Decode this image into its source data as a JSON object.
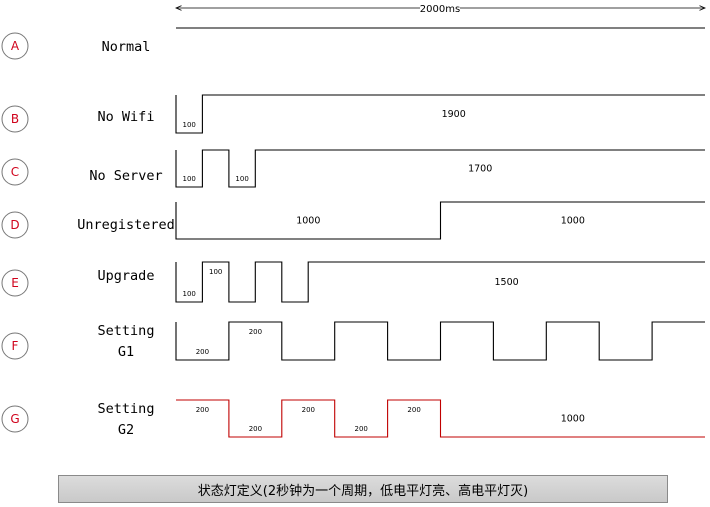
{
  "period": "2000ms",
  "colors": {
    "normal_wave": "#000000",
    "highlight_wave": "#c00000",
    "badge": "#d0021b",
    "highlight_text": "#3355dd"
  },
  "rows": [
    {
      "letter": "A",
      "label": [
        "Normal"
      ],
      "highlight": false,
      "segments": [
        {
          "level": "high",
          "ms": 2000,
          "label": ""
        }
      ]
    },
    {
      "letter": "B",
      "label": [
        "No Wifi"
      ],
      "highlight": false,
      "segments": [
        {
          "level": "low",
          "ms": 100,
          "label": "100"
        },
        {
          "level": "high",
          "ms": 1900,
          "label": "1900"
        }
      ]
    },
    {
      "letter": "C",
      "label": [
        "No Server"
      ],
      "highlight": false,
      "segments": [
        {
          "level": "low",
          "ms": 100,
          "label": "100"
        },
        {
          "level": "high",
          "ms": 100,
          "label": ""
        },
        {
          "level": "low",
          "ms": 100,
          "label": "100"
        },
        {
          "level": "high",
          "ms": 1700,
          "label": "1700"
        }
      ]
    },
    {
      "letter": "D",
      "label": [
        "Unregistered"
      ],
      "highlight": false,
      "segments": [
        {
          "level": "low",
          "ms": 1000,
          "label": "1000"
        },
        {
          "level": "high",
          "ms": 1000,
          "label": "1000"
        }
      ]
    },
    {
      "letter": "E",
      "label": [
        "Upgrade"
      ],
      "highlight": false,
      "segments": [
        {
          "level": "low",
          "ms": 100,
          "label": "100"
        },
        {
          "level": "high",
          "ms": 100,
          "label": "100"
        },
        {
          "level": "low",
          "ms": 100,
          "label": ""
        },
        {
          "level": "high",
          "ms": 100,
          "label": ""
        },
        {
          "level": "low",
          "ms": 100,
          "label": ""
        },
        {
          "level": "high",
          "ms": 1500,
          "label": "1500"
        }
      ]
    },
    {
      "letter": "F",
      "label": [
        "Setting",
        "G1"
      ],
      "highlight": false,
      "segments": [
        {
          "level": "low",
          "ms": 200,
          "label": "200"
        },
        {
          "level": "high",
          "ms": 200,
          "label": "200"
        },
        {
          "level": "low",
          "ms": 200,
          "label": ""
        },
        {
          "level": "high",
          "ms": 200,
          "label": ""
        },
        {
          "level": "low",
          "ms": 200,
          "label": ""
        },
        {
          "level": "high",
          "ms": 200,
          "label": ""
        },
        {
          "level": "low",
          "ms": 200,
          "label": ""
        },
        {
          "level": "high",
          "ms": 200,
          "label": ""
        },
        {
          "level": "low",
          "ms": 200,
          "label": ""
        },
        {
          "level": "high",
          "ms": 200,
          "label": ""
        }
      ]
    },
    {
      "letter": "G",
      "label": [
        "Setting",
        "G2"
      ],
      "highlight": true,
      "segments": [
        {
          "level": "high",
          "ms": 200,
          "label": "200"
        },
        {
          "level": "low",
          "ms": 200,
          "label": "200"
        },
        {
          "level": "high",
          "ms": 200,
          "label": "200"
        },
        {
          "level": "low",
          "ms": 200,
          "label": "200"
        },
        {
          "level": "high",
          "ms": 200,
          "label": "200"
        },
        {
          "level": "low",
          "ms": 1000,
          "label": "1000"
        }
      ]
    }
  ],
  "caption": "状态灯定义(2秒钟为一个周期，低电平灯亮、高电平灯灭)"
}
